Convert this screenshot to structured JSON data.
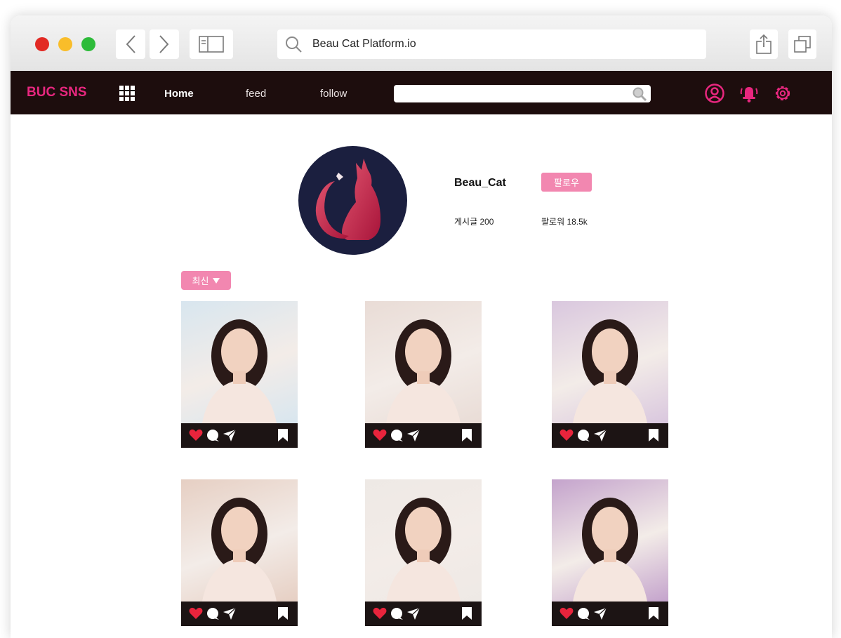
{
  "browser": {
    "url": "Beau Cat Platform.io"
  },
  "nav": {
    "brand": "BUC SNS",
    "links": [
      "Home",
      "feed",
      "follow"
    ],
    "search_placeholder": "",
    "accent": "#e8277f",
    "icons": [
      "apps-grid-icon",
      "user-circle-icon",
      "bell-icon",
      "gear-icon"
    ]
  },
  "profile": {
    "username": "Beau_Cat",
    "follow_label": "팔로우",
    "posts_stat": "게시글 200",
    "followers_stat": "팔로워 18.5k"
  },
  "sort": {
    "label": "최신"
  },
  "posts": [
    {
      "photo_bg": "#d8e6ef",
      "actions": [
        "heart-icon",
        "comment-icon",
        "send-icon",
        "bookmark-icon"
      ]
    },
    {
      "photo_bg": "#e9dcd6",
      "actions": [
        "heart-icon",
        "comment-icon",
        "send-icon",
        "bookmark-icon"
      ]
    },
    {
      "photo_bg": "#d9c7de",
      "actions": [
        "heart-icon",
        "comment-icon",
        "send-icon",
        "bookmark-icon"
      ]
    },
    {
      "photo_bg": "#e6cfc3",
      "actions": [
        "heart-icon",
        "comment-icon",
        "send-icon",
        "bookmark-icon"
      ]
    },
    {
      "photo_bg": "#eee9e5",
      "actions": [
        "heart-icon",
        "comment-icon",
        "send-icon",
        "bookmark-icon"
      ]
    },
    {
      "photo_bg": "#c4a3cc",
      "actions": [
        "heart-icon",
        "comment-icon",
        "send-icon",
        "bookmark-icon"
      ]
    }
  ]
}
